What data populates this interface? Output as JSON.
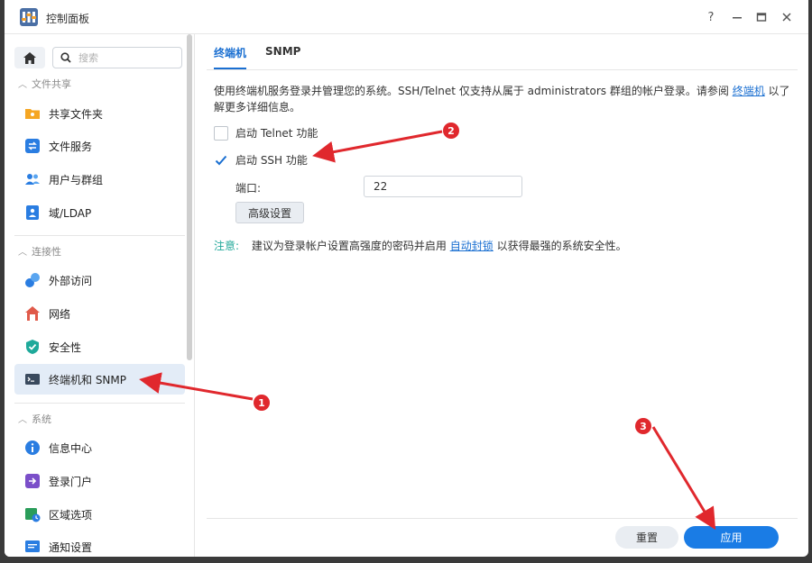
{
  "window": {
    "title": "控制面板",
    "controls": [
      "?",
      "—",
      "▭",
      "✕"
    ]
  },
  "sidebar": {
    "search_placeholder": "搜索",
    "sections": [
      {
        "label": "文件共享",
        "items": [
          {
            "label": "共享文件夹",
            "icon": "shared-folder-icon"
          },
          {
            "label": "文件服务",
            "icon": "file-services-icon"
          },
          {
            "label": "用户与群组",
            "icon": "users-groups-icon"
          },
          {
            "label": "域/LDAP",
            "icon": "domain-ldap-icon"
          }
        ]
      },
      {
        "label": "连接性",
        "items": [
          {
            "label": "外部访问",
            "icon": "external-access-icon"
          },
          {
            "label": "网络",
            "icon": "network-icon"
          },
          {
            "label": "安全性",
            "icon": "security-icon"
          },
          {
            "label": "终端机和 SNMP",
            "icon": "terminal-icon",
            "active": true
          }
        ]
      },
      {
        "label": "系统",
        "items": [
          {
            "label": "信息中心",
            "icon": "info-center-icon"
          },
          {
            "label": "登录门户",
            "icon": "login-portal-icon"
          },
          {
            "label": "区域选项",
            "icon": "regional-options-icon"
          },
          {
            "label": "通知设置",
            "icon": "notification-icon"
          }
        ]
      }
    ]
  },
  "main": {
    "tabs": [
      {
        "label": "终端机",
        "active": true
      },
      {
        "label": "SNMP",
        "active": false
      }
    ],
    "description_prefix": "使用终端机服务登录并管理您的系统。SSH/Telnet 仅支持从属于 administrators 群组的帐户登录。请参阅",
    "description_link": "终端机",
    "description_suffix": "以了解更多详细信息。",
    "telnet_label": "启动 Telnet 功能",
    "telnet_checked": false,
    "ssh_label": "启动 SSH 功能",
    "ssh_checked": true,
    "port_label": "端口:",
    "port_value": "22",
    "advanced_button": "高级设置",
    "note_label": "注意:",
    "note_prefix": "建议为登录帐户设置高强度的密码并启用",
    "note_link": "自动封锁",
    "note_suffix": "以获得最强的系统安全性。",
    "reset_button": "重置",
    "apply_button": "应用"
  },
  "annotations": {
    "badge_1": "1",
    "badge_2": "2",
    "badge_3": "3"
  },
  "colors": {
    "accent": "#1a7ce5",
    "annotation": "#e0282d",
    "note": "#22a89a"
  }
}
